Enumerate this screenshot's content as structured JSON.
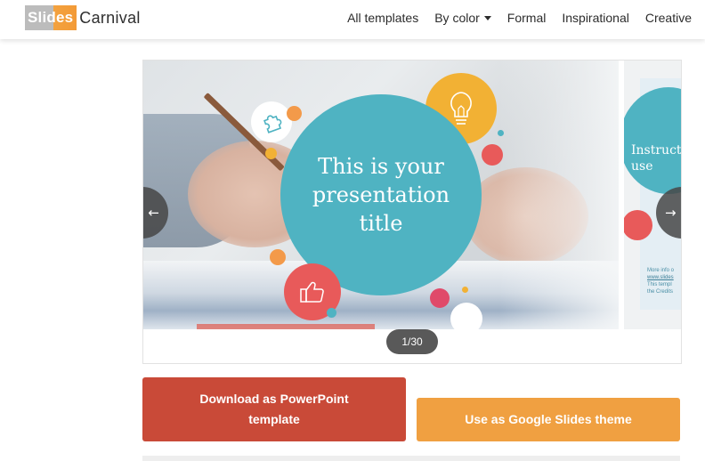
{
  "logo": {
    "part1": "Slides",
    "part2": "Carnival"
  },
  "nav": {
    "items": [
      "All templates",
      "By color",
      "Formal",
      "Inspirational",
      "Creative"
    ]
  },
  "carousel": {
    "slide_title": "This is your presentation title",
    "next_slide_title": "Instruct\nuse",
    "next_slide_small_line1": "More info o",
    "next_slide_small_link": "www.slides",
    "next_slide_small_line3": "This templ",
    "next_slide_small_line4": "the Credits",
    "counter": "1/30",
    "prev_arrow": "←",
    "next_arrow": "→"
  },
  "buttons": {
    "download_ppt": "Download as PowerPoint template",
    "google_slides": "Use as Google Slides theme"
  },
  "colors": {
    "teal": "#4fb3c2",
    "red_button": "#c94a38",
    "orange_button": "#f0a041",
    "accent_yellow": "#f2b134",
    "accent_coral": "#e85a5a",
    "accent_orange": "#f39a4a",
    "accent_pink": "#e04a6a"
  },
  "icons": [
    "puzzle-icon",
    "lightbulb-icon",
    "thumbs-up-icon",
    "arrow-left-icon",
    "arrow-right-icon",
    "caret-down-icon"
  ]
}
